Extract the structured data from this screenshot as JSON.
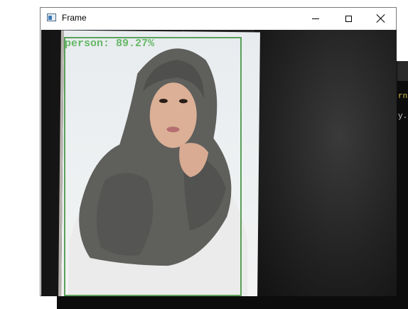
{
  "window": {
    "title": "Frame",
    "controls": {
      "minimize": "minimize",
      "maximize": "maximize",
      "close": "close"
    }
  },
  "detection": {
    "label": "person: 89.27%",
    "box_color": "#5aa05a"
  },
  "background_console": {
    "line1": "rn",
    "line2": "y.",
    "line1_color": "#d8c24a"
  }
}
